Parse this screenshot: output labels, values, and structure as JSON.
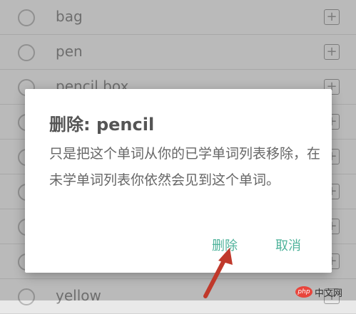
{
  "word_list": [
    {
      "word": "bag",
      "add_symbol": "+"
    },
    {
      "word": "pen",
      "add_symbol": "+"
    },
    {
      "word": "pencil box",
      "add_symbol": "+"
    },
    {
      "word": "",
      "add_symbol": "+"
    },
    {
      "word": "",
      "add_symbol": "+"
    },
    {
      "word": "",
      "add_symbol": "+"
    },
    {
      "word": "",
      "add_symbol": "+"
    },
    {
      "word": "",
      "add_symbol": "+"
    },
    {
      "word": "yellow",
      "add_symbol": "+"
    }
  ],
  "dialog": {
    "title": "删除: pencil",
    "message": "只是把这个单词从你的已学单词列表移除，在未学单词列表你依然会见到这个单词。",
    "delete_label": "删除",
    "cancel_label": "取消"
  },
  "watermark": {
    "logo": "php",
    "text": "中文网"
  },
  "colors": {
    "accent": "#4fb39b",
    "annotation_arrow": "#c0392b"
  }
}
